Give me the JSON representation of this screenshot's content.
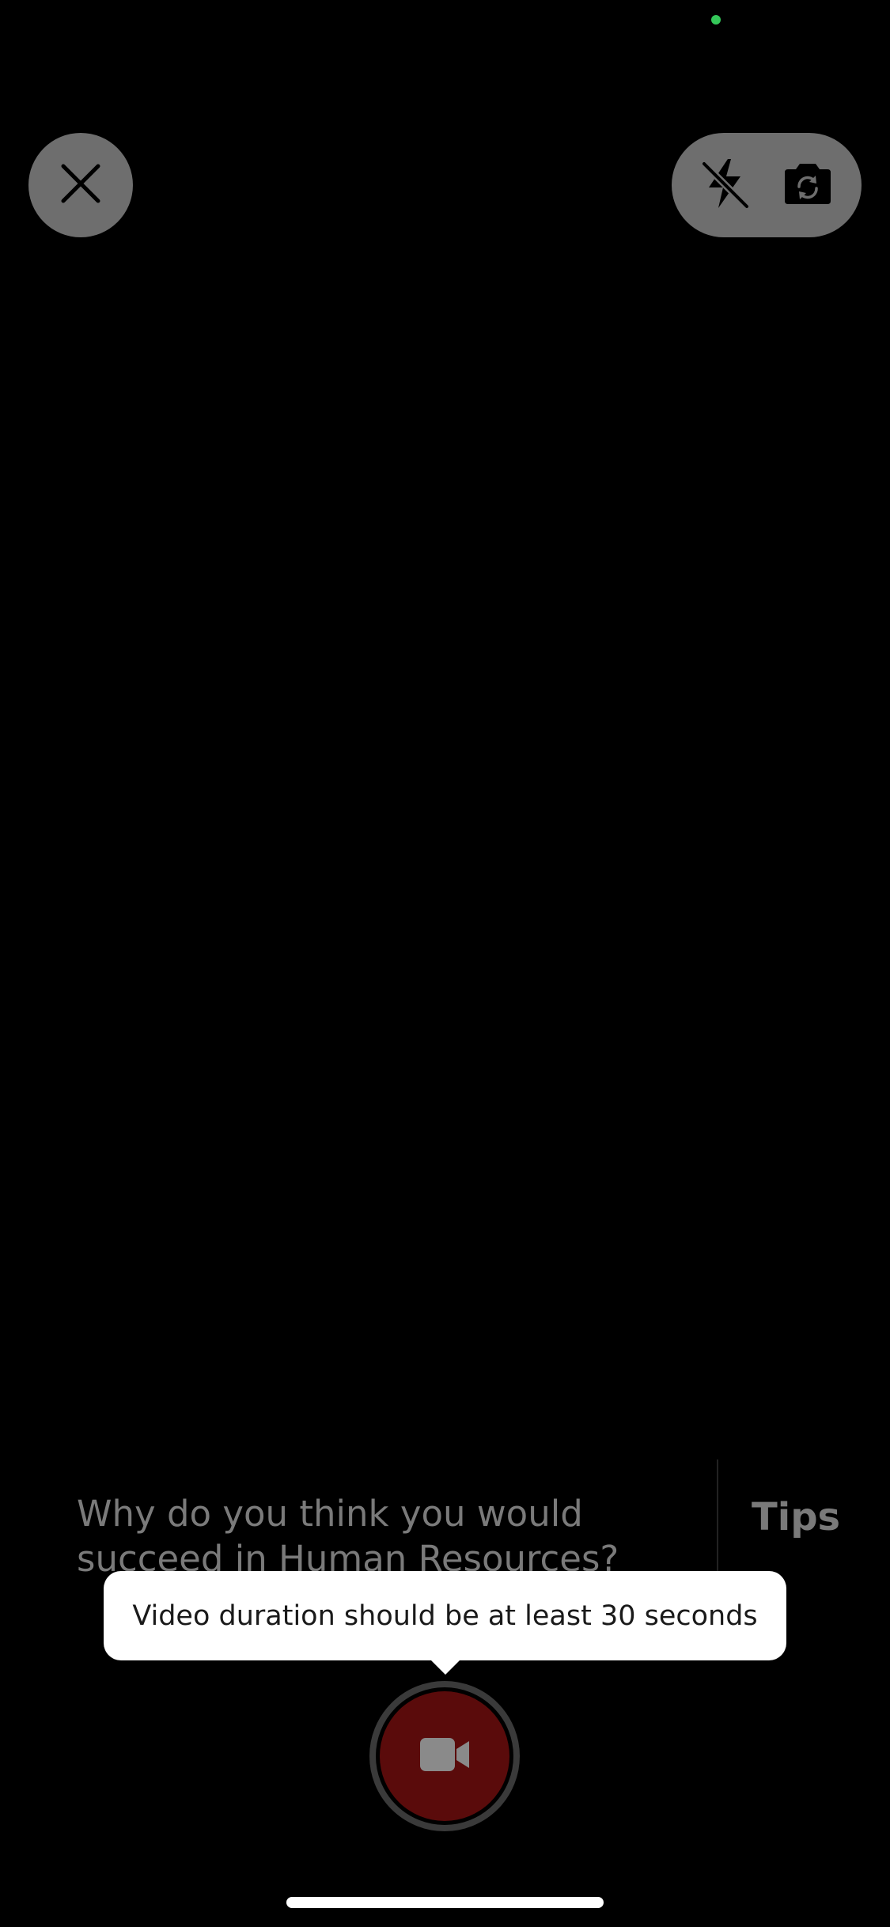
{
  "colors": {
    "background": "#000000",
    "status_dot": "#34c759",
    "control_bg": "#6e6e6e",
    "question_text": "#7a7a7a",
    "tips_text": "#7a7a7a",
    "record_fill": "#5a0b0b",
    "record_icon": "#8a8a8a",
    "tooltip_bg": "#ffffff"
  },
  "top_controls": {
    "close_icon": "close-icon",
    "flash_icon": "flash-off-icon",
    "switch_camera_icon": "switch-camera-icon"
  },
  "question": {
    "text": "Why do you think you would succeed in Human Resources?",
    "tips_label": "Tips"
  },
  "tooltip": {
    "message": "Video duration should be at least 30 seconds"
  },
  "record": {
    "icon": "video-camera-icon"
  }
}
